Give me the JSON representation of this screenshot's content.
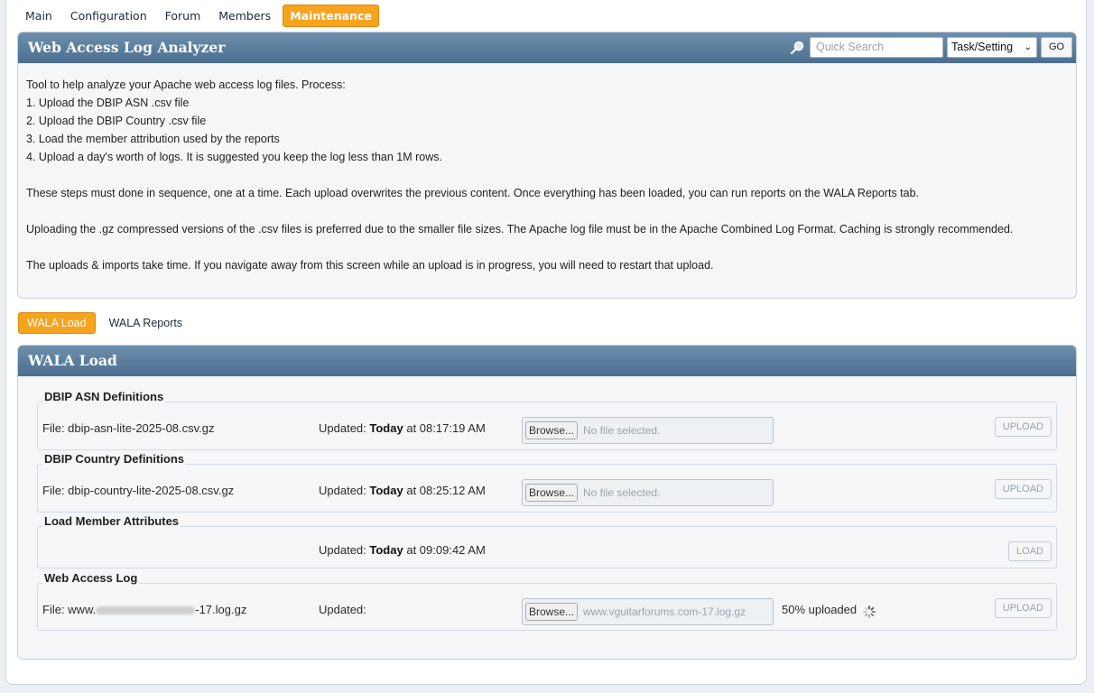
{
  "top_nav": [
    {
      "label": "Main",
      "active": false
    },
    {
      "label": "Configuration",
      "active": false
    },
    {
      "label": "Forum",
      "active": false
    },
    {
      "label": "Members",
      "active": false
    },
    {
      "label": "Maintenance",
      "active": true
    }
  ],
  "analyzer_panel": {
    "title": "Web Access Log Analyzer",
    "search_placeholder": "Quick Search",
    "search_select": "Task/Setting",
    "go_label": "GO",
    "intro_lines": [
      "Tool to help analyze your Apache web access log files. Process:",
      "1. Upload the DBIP ASN .csv file",
      "2. Upload the DBIP Country .csv file",
      "3. Load the member attribution used by the reports",
      "4. Upload a day's worth of logs. It is suggested you keep the log less than 1M rows."
    ],
    "para_sequence": "These steps must done in sequence, one at a time. Each upload overwrites the previous content. Once everything has been loaded, you can run reports on the WALA Reports tab.",
    "para_gz": "Uploading the .gz compressed versions of the .csv files is preferred due to the smaller file sizes. The Apache log file must be in the Apache Combined Log Format. Caching is strongly recommended.",
    "para_time": "The uploads & imports take time. If you navigate away from this screen while an upload is in progress, you will need to restart that upload."
  },
  "sub_tabs": [
    {
      "label": "WALA Load",
      "active": true
    },
    {
      "label": "WALA Reports",
      "active": false
    }
  ],
  "load_panel": {
    "title": "WALA Load",
    "asn": {
      "legend": "DBIP ASN Definitions",
      "file": "File: dbip-asn-lite-2025-08.csv.gz",
      "updated_label": "Updated:",
      "updated_day": "Today",
      "updated_time": "at 08:17:19 AM",
      "browse": "Browse...",
      "file_status": "No file selected.",
      "button": "UPLOAD"
    },
    "country": {
      "legend": "DBIP Country Definitions",
      "file": "File: dbip-country-lite-2025-08.csv.gz",
      "updated_label": "Updated:",
      "updated_day": "Today",
      "updated_time": "at 08:25:12 AM",
      "browse": "Browse...",
      "file_status": "No file selected.",
      "button": "UPLOAD"
    },
    "members": {
      "legend": "Load Member Attributes",
      "updated_label": "Updated:",
      "updated_day": "Today",
      "updated_time": "at 09:09:42 AM",
      "button": "LOAD"
    },
    "weblog": {
      "legend": "Web Access Log",
      "file_prefix": "File: www.",
      "file_suffix": "-17.log.gz",
      "updated_label": "Updated:",
      "browse": "Browse...",
      "file_status": "www.vguitarforums.com-17.log.gz",
      "progress_text": "50% uploaded",
      "progress_percent": 50,
      "button": "UPLOAD"
    }
  },
  "colors": {
    "accent_orange": "#f6a31e",
    "panel_header": "#5a7c9c"
  }
}
